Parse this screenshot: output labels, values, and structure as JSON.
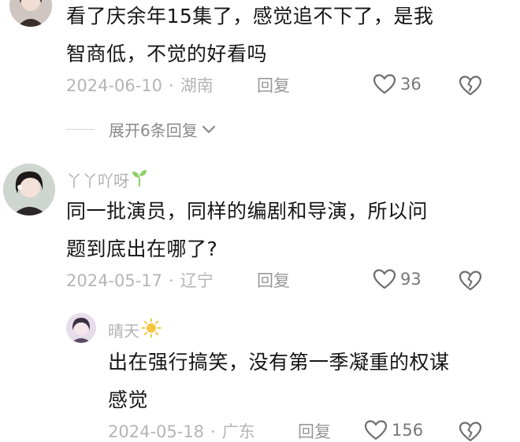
{
  "comments": [
    {
      "text_line1": "看了庆余年15集了，感觉追不下了，是我",
      "text_line2": "智商低，不觉的好看吗",
      "date": "2024-06-10",
      "location": "湖南",
      "reply_label": "回复",
      "likes": "36",
      "expand_label": "展开6条回复"
    },
    {
      "username": "丫丫吖呀",
      "text_line1": "同一批演员，同样的编剧和导演，所以问",
      "text_line2": "题到底出在哪了?",
      "date": "2024-05-17",
      "location": "辽宁",
      "reply_label": "回复",
      "likes": "93"
    }
  ],
  "reply": {
    "username": "晴天",
    "text_line1": "出在强行搞笑，没有第一季凝重的权谋",
    "text_line2": "感觉",
    "date": "2024-05-18",
    "location": "广东",
    "reply_label": "回复",
    "likes": "156"
  },
  "separator": "·",
  "colors": {
    "accent_sprout": "#8fcf6a",
    "sun": "#f5c542"
  }
}
